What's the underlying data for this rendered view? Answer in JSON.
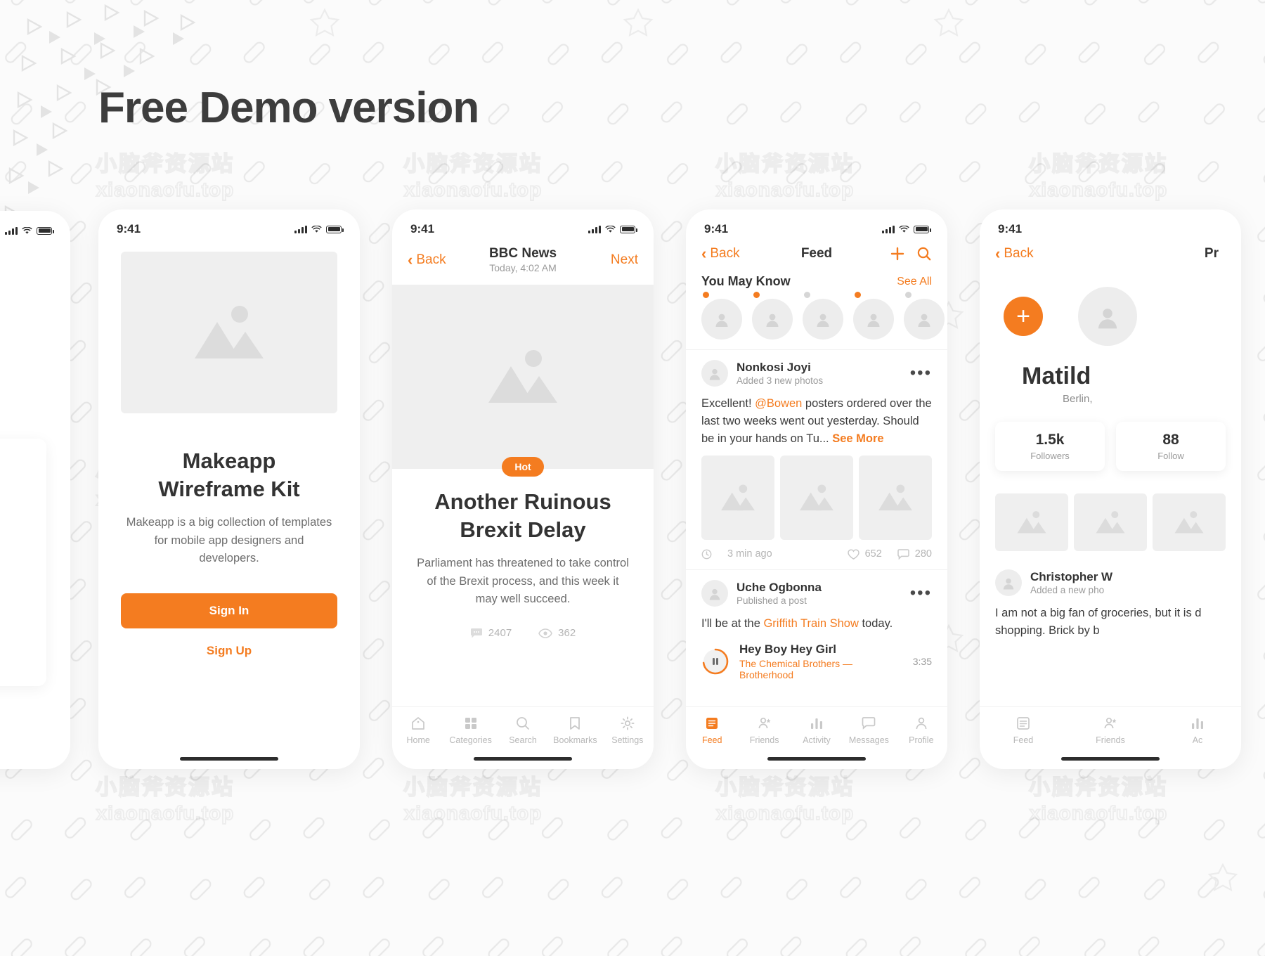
{
  "page": {
    "title": "Free Demo version",
    "watermark_cn": "小脑斧资源站",
    "watermark_en": "xiaonaofu.top"
  },
  "phone1": {
    "status": {
      "time": "9:41"
    },
    "title_line1": "Makeapp",
    "title_line2": "Wireframe Kit",
    "description": "Makeapp is a big collection of templates for mobile app designers and developers.",
    "primary_button": "Sign In",
    "secondary_button": "Sign Up"
  },
  "phone2": {
    "status": {
      "time": "9:41"
    },
    "nav": {
      "back": "Back",
      "title": "BBC News",
      "subtitle": "Today, 4:02 AM",
      "next": "Next"
    },
    "badge": "Hot",
    "title_line1": "Another Ruinous",
    "title_line2": "Brexit Delay",
    "description": "Parliament has threatened to take control of the Brexit process, and this week it may well succeed.",
    "stats": {
      "comments": "2407",
      "views": "362"
    },
    "tabs": [
      {
        "label": "Home",
        "icon": "home-icon",
        "active": false
      },
      {
        "label": "Categories",
        "icon": "grid-icon",
        "active": false
      },
      {
        "label": "Search",
        "icon": "search-icon",
        "active": false
      },
      {
        "label": "Bookmarks",
        "icon": "bookmark-icon",
        "active": false
      },
      {
        "label": "Settings",
        "icon": "gear-icon",
        "active": false
      }
    ]
  },
  "phone3": {
    "status": {
      "time": "9:41"
    },
    "nav": {
      "back": "Back",
      "title": "Feed"
    },
    "suggestions": {
      "title": "You May Know",
      "see_all": "See All"
    },
    "suggestion_dots": [
      "#F47C20",
      "#F47C20",
      "#d6d6d6",
      "#F47C20",
      "#d6d6d6"
    ],
    "posts": [
      {
        "name": "Nonkosi Joyi",
        "meta": "Added 3 new photos",
        "text_before": "Excellent! ",
        "mention": "@Bowen",
        "text_after": " posters ordered over the last two weeks went out yesterday. Should be in your hands on Tu...",
        "see_more": "See More",
        "time": "3 min ago",
        "likes": "652",
        "comments": "280"
      },
      {
        "name": "Uche Ogbonna",
        "meta": "Published a post",
        "text_before": "I'll be at the ",
        "mention": "Griffith Train Show",
        "text_after": " today.",
        "music": {
          "title": "Hey Boy Hey Girl",
          "artist": "The Chemical Brothers — Brotherhood",
          "duration": "3:35"
        }
      }
    ],
    "tabs": [
      {
        "label": "Feed",
        "icon": "feed-icon",
        "active": true
      },
      {
        "label": "Friends",
        "icon": "friends-icon",
        "active": false
      },
      {
        "label": "Activity",
        "icon": "activity-icon",
        "active": false
      },
      {
        "label": "Messages",
        "icon": "messages-icon",
        "active": false
      },
      {
        "label": "Profile",
        "icon": "profile-icon",
        "active": false
      }
    ]
  },
  "phone4": {
    "status": {
      "time": "9:41"
    },
    "nav": {
      "back": "Back",
      "title": "Pr"
    },
    "name": "Matild",
    "location": "Berlin,",
    "stats": [
      {
        "value": "1.5k",
        "label": "Followers"
      },
      {
        "value": "88",
        "label": "Follow"
      }
    ],
    "post": {
      "name": "Christopher W",
      "meta": "Added a new pho",
      "text": "I am not a big fan of groceries, but it is d shopping. Brick by b"
    },
    "tabs": [
      {
        "label": "Feed",
        "icon": "feed-icon",
        "active": false
      },
      {
        "label": "Friends",
        "icon": "friends-icon",
        "active": false
      },
      {
        "label": "Ac",
        "icon": "activity-icon",
        "active": false
      }
    ]
  },
  "colors": {
    "accent": "#F47C20",
    "text": "#333333",
    "muted": "#9b9b9b"
  }
}
